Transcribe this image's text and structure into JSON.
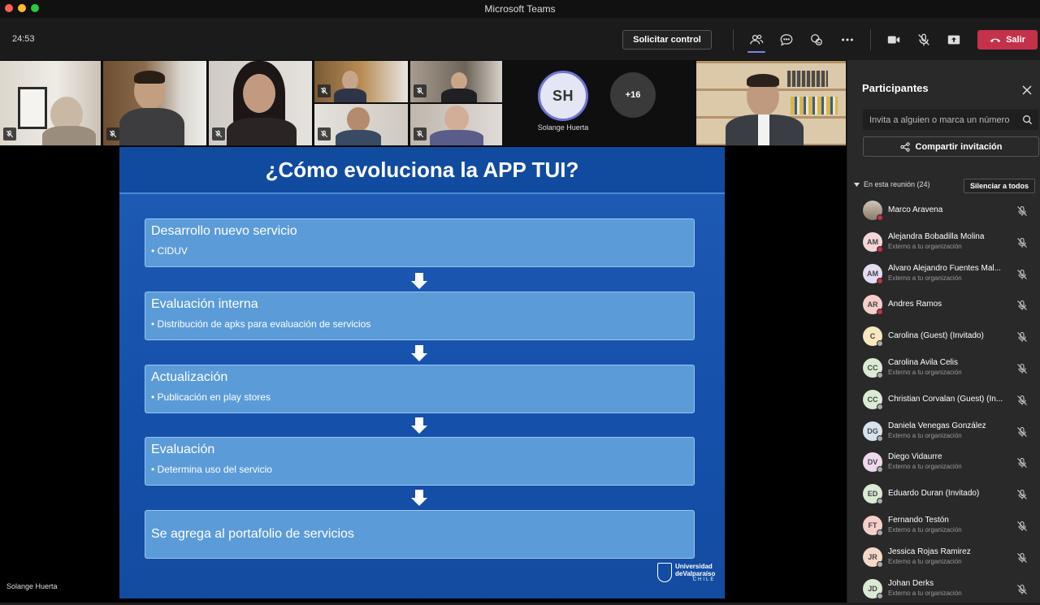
{
  "window": {
    "title": "Microsoft Teams"
  },
  "toolbar": {
    "timer": "24:53",
    "control_label": "Solicitar control",
    "leave_label": "Salir",
    "icons": [
      "participants-icon",
      "chat-icon",
      "reactions-icon",
      "more-options-icon",
      "camera-icon",
      "mic-muted-icon",
      "share-screen-icon",
      "phone-hangup-icon"
    ]
  },
  "video_strip": {
    "avatar_initials": "SH",
    "avatar_name": "Solange Huerta",
    "more_count": "+16"
  },
  "slide": {
    "title": "¿Cómo evoluciona la APP TUI?",
    "steps": [
      {
        "title": "Desarrollo nuevo servicio",
        "sub": "• CIDUV"
      },
      {
        "title": "Evaluación interna",
        "sub": "• Distribución de apks para evaluación de servicios"
      },
      {
        "title": "Actualización",
        "sub": "• Publicación en play stores"
      },
      {
        "title": "Evaluación",
        "sub": "• Determina uso del servicio"
      },
      {
        "title": "Se agrega al portafolio de servicios",
        "sub": ""
      }
    ],
    "logo_line1": "Universidad",
    "logo_line2": "deValparaíso",
    "logo_line3": "CHILE"
  },
  "stage": {
    "presenter_name": "Solange Huerta"
  },
  "participants_panel": {
    "title": "Participantes",
    "invite_placeholder": "Invita a alguien o marca un número",
    "share_label": "Compartir invitación",
    "section_label": "En esta reunión (24)",
    "mute_all_label": "Silenciar a todos",
    "participants": [
      {
        "initials": "",
        "name": "Marco Aravena",
        "org": "",
        "avatar_color": "#d9cfc4",
        "status": "#c4314b",
        "photo": true
      },
      {
        "initials": "AM",
        "name": "Alejandra Bobadilla Molina",
        "org": "Externo a tu organización",
        "avatar_color": "#f3d6d8",
        "status": "#c4314b"
      },
      {
        "initials": "AM",
        "name": "Alvaro Alejandro Fuentes Mal...",
        "org": "Externo a tu organización",
        "avatar_color": "#e3dcf2",
        "status": "#c4314b"
      },
      {
        "initials": "AR",
        "name": "Andres Ramos",
        "org": "",
        "avatar_color": "#f6cfc9",
        "status": "#c4314b"
      },
      {
        "initials": "C",
        "name": "Carolina (Guest) (Invitado)",
        "org": "",
        "avatar_color": "#f7e6bf",
        "status": "#aaaaaa"
      },
      {
        "initials": "CC",
        "name": "Carolina Avila Celis",
        "org": "Externo a tu organización",
        "avatar_color": "#dbead4",
        "status": "#aaaaaa"
      },
      {
        "initials": "CC",
        "name": "Christian Corvalan (Guest) (In...",
        "org": "",
        "avatar_color": "#dbead4",
        "status": "#aaaaaa"
      },
      {
        "initials": "DG",
        "name": "Daniela Venegas González",
        "org": "Externo a tu organización",
        "avatar_color": "#d6e3ee",
        "status": "#aaaaaa"
      },
      {
        "initials": "DV",
        "name": "Diego Vidaurre",
        "org": "Externo a tu organización",
        "avatar_color": "#eed8ee",
        "status": "#aaaaaa"
      },
      {
        "initials": "ED",
        "name": "Eduardo Duran (Invitado)",
        "org": "",
        "avatar_color": "#dbead4",
        "status": "#aaaaaa"
      },
      {
        "initials": "FT",
        "name": "Fernando Testón",
        "org": "Externo a tu organización",
        "avatar_color": "#f6cfc9",
        "status": "#aaaaaa"
      },
      {
        "initials": "JR",
        "name": "Jessica Rojas Ramirez",
        "org": "Externo a tu organización",
        "avatar_color": "#f6d8c9",
        "status": "#aaaaaa"
      },
      {
        "initials": "JD",
        "name": "Johan Derks",
        "org": "Externo a tu organización",
        "avatar_color": "#dbead4",
        "status": "#aaaaaa"
      }
    ]
  }
}
